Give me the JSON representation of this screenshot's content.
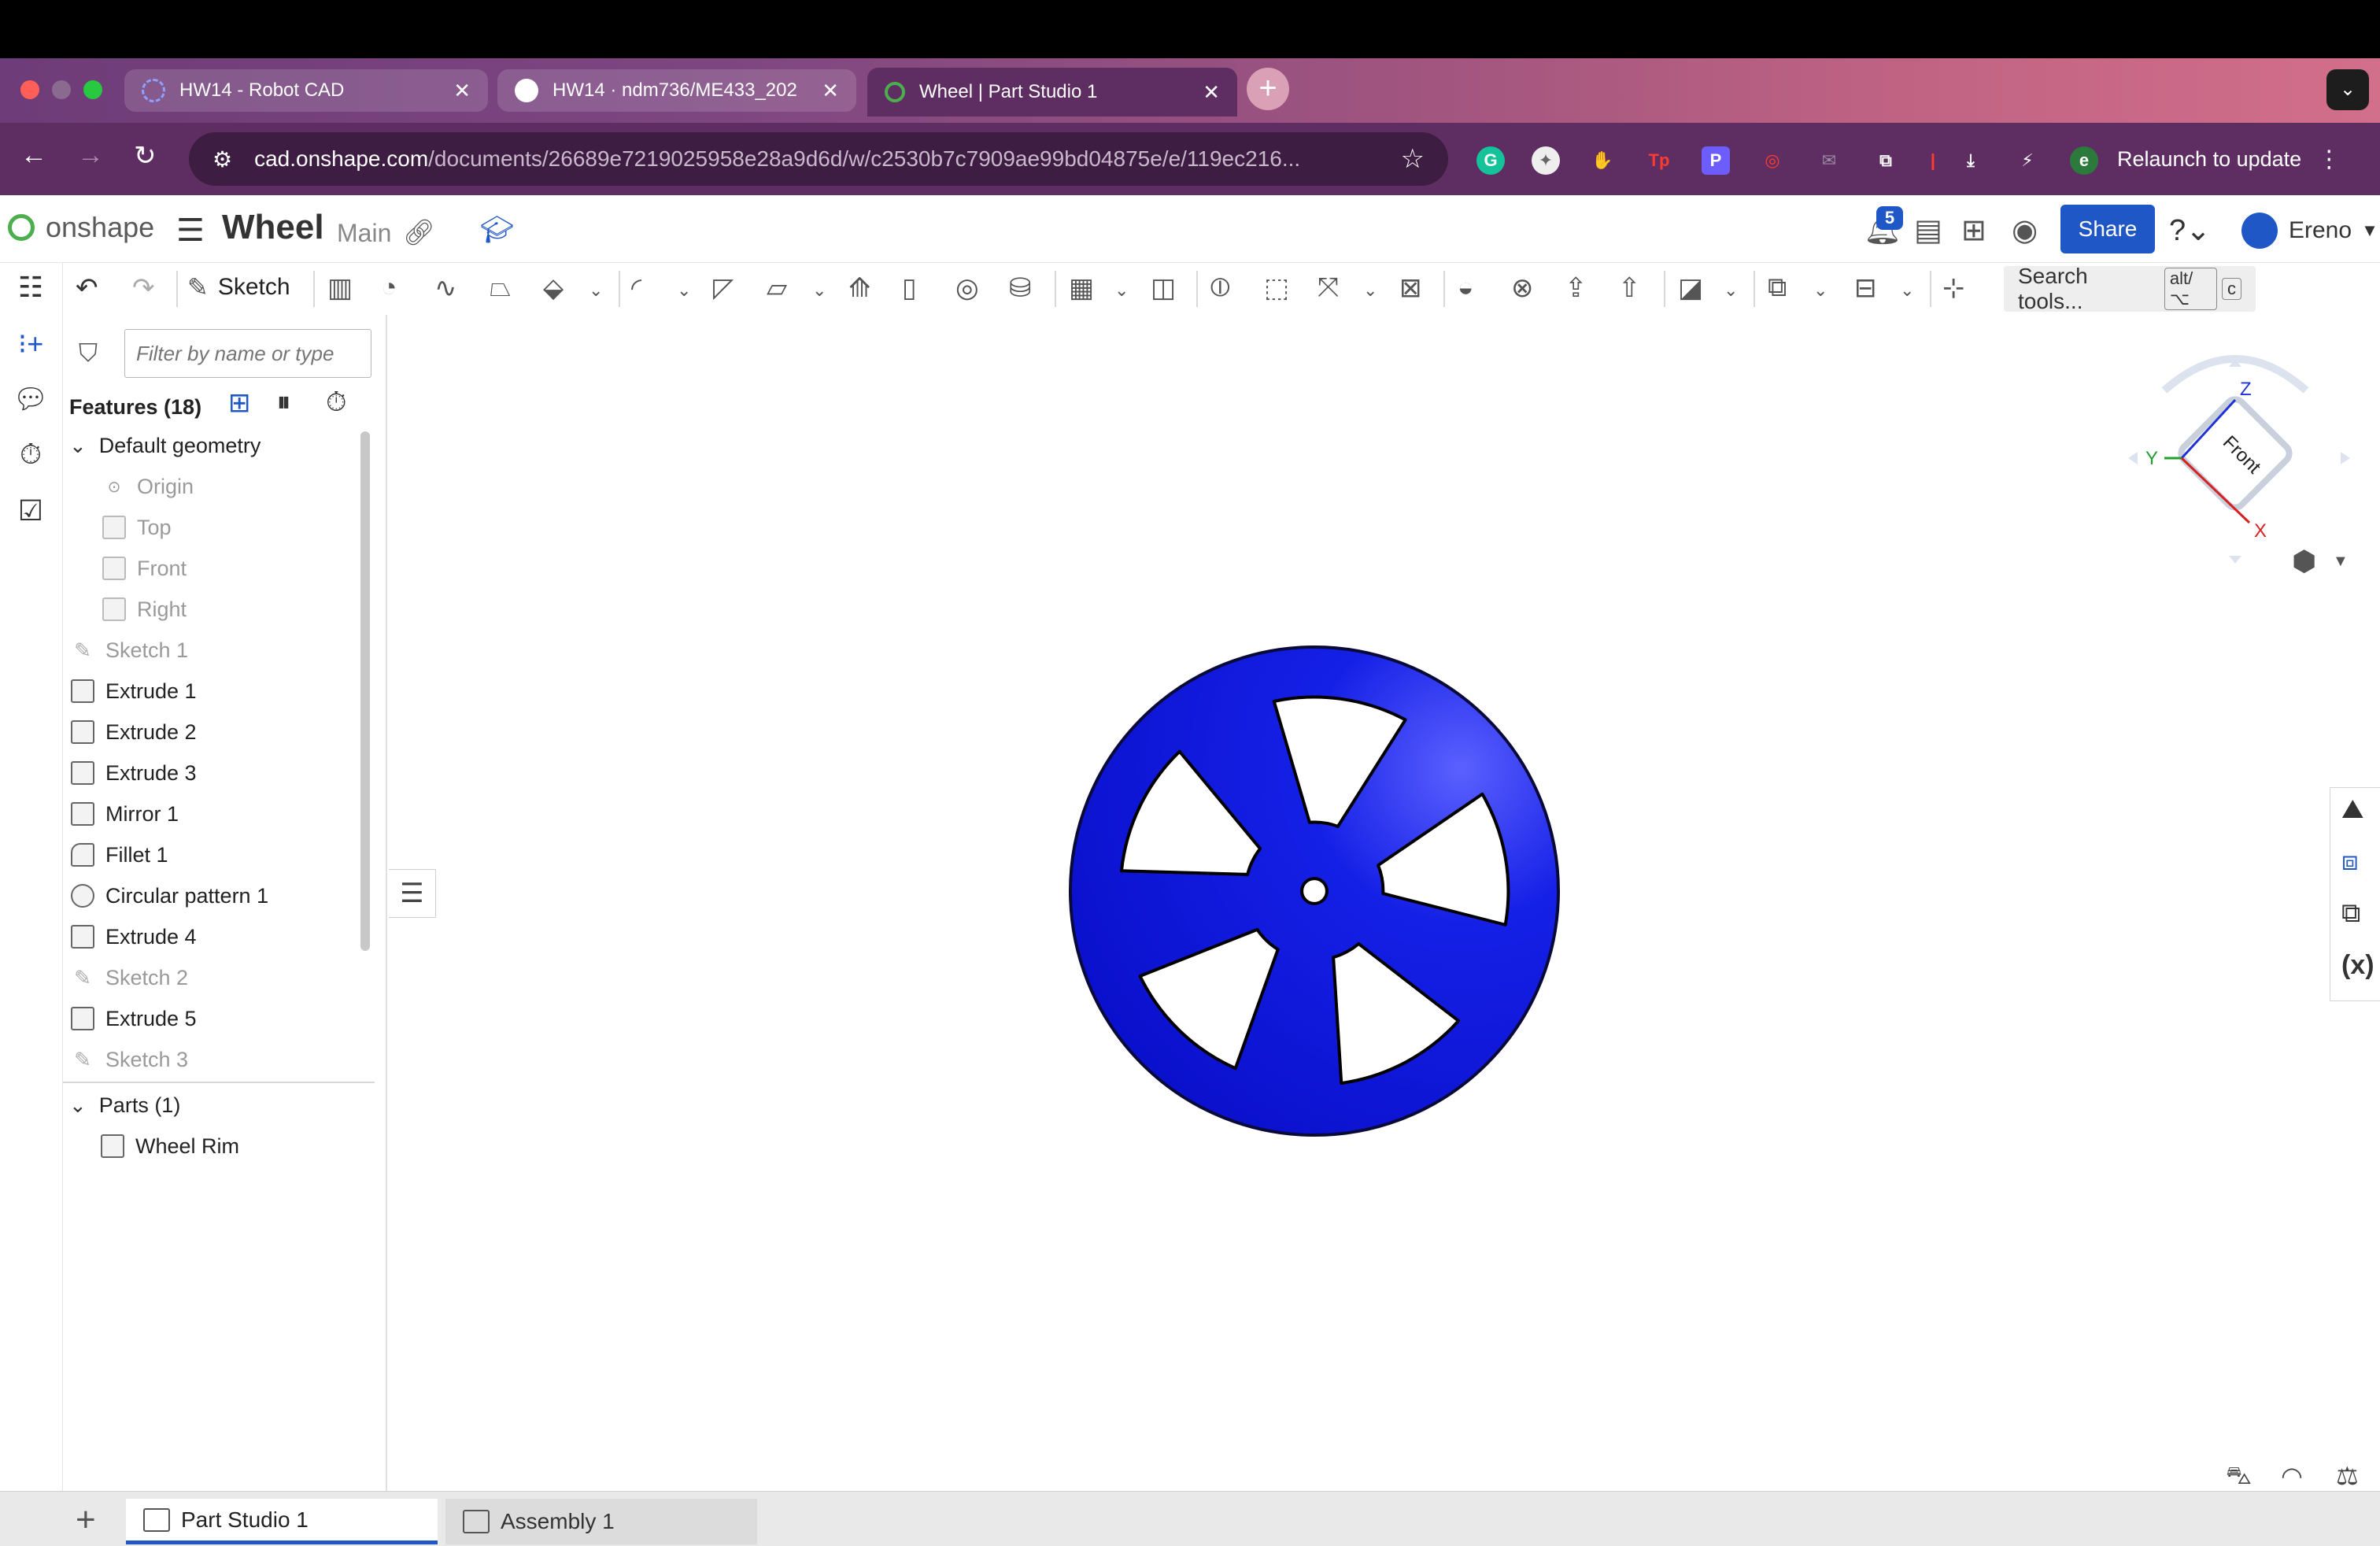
{
  "browser": {
    "tabs": [
      {
        "title": "HW14 - Robot CAD",
        "favicon": "loading-ring-icon",
        "active": false
      },
      {
        "title": "HW14 · ndm736/ME433_202",
        "favicon": "github-icon",
        "active": false
      },
      {
        "title": "Wheel | Part Studio 1",
        "favicon": "onshape-icon",
        "active": true
      }
    ],
    "url_host": "cad.onshape.com",
    "url_path": "/documents/26689e7219025958e28a9d6d/w/c2530b7c7909ae99bd04875e/e/119ec216...",
    "relaunch_label": "Relaunch to update",
    "profile_initial": "e"
  },
  "header": {
    "brand": "onshape",
    "doc_title": "Wheel",
    "branch": "Main",
    "notifications": "5",
    "share_label": "Share",
    "user_name": "Ereno"
  },
  "toolbar": {
    "sketch_label": "Sketch",
    "search_label": "Search tools...",
    "search_key1": "alt/⌥",
    "search_key2": "c"
  },
  "features": {
    "filter_placeholder": "Filter by name or type",
    "header": "Features (18)",
    "default_geometry": "Default geometry",
    "items": [
      {
        "label": "Origin",
        "kind": "origin",
        "muted": true
      },
      {
        "label": "Top",
        "kind": "plane",
        "muted": true
      },
      {
        "label": "Front",
        "kind": "plane",
        "muted": true
      },
      {
        "label": "Right",
        "kind": "plane",
        "muted": true
      },
      {
        "label": "Sketch 1",
        "kind": "sketch",
        "muted": true
      },
      {
        "label": "Extrude 1",
        "kind": "extrude",
        "muted": false
      },
      {
        "label": "Extrude 2",
        "kind": "extrude",
        "muted": false
      },
      {
        "label": "Extrude 3",
        "kind": "extrude",
        "muted": false
      },
      {
        "label": "Mirror 1",
        "kind": "mirror",
        "muted": false
      },
      {
        "label": "Fillet 1",
        "kind": "fillet",
        "muted": false
      },
      {
        "label": "Circular pattern 1",
        "kind": "pattern",
        "muted": false
      },
      {
        "label": "Extrude 4",
        "kind": "extrude",
        "muted": false
      },
      {
        "label": "Sketch 2",
        "kind": "sketch",
        "muted": true
      },
      {
        "label": "Extrude 5",
        "kind": "extrude",
        "muted": false
      },
      {
        "label": "Sketch 3",
        "kind": "sketch",
        "muted": true
      }
    ],
    "parts_header": "Parts (1)",
    "parts": [
      {
        "label": "Wheel Rim"
      }
    ]
  },
  "view_cube": {
    "face": "Front",
    "axis_z": "Z",
    "axis_y": "Y",
    "axis_x": "X"
  },
  "colors": {
    "part_blue": "#0a10d9",
    "accent": "#1f57c7"
  },
  "bottom_tabs": [
    {
      "label": "Part Studio 1",
      "active": true
    },
    {
      "label": "Assembly 1",
      "active": false
    }
  ]
}
